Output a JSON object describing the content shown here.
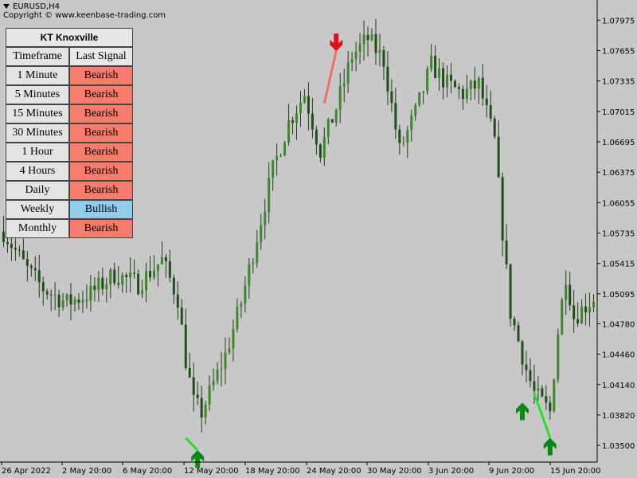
{
  "header": {
    "symbol_line": "EURUSD,H4",
    "copyright": "Copyright © www.keenbase-trading.com"
  },
  "panel": {
    "title": "KT Knoxville",
    "col_timeframe": "Timeframe",
    "col_signal": "Last Signal",
    "rows": [
      {
        "timeframe": "1 Minute",
        "signal": "Bearish"
      },
      {
        "timeframe": "5 Minutes",
        "signal": "Bearish"
      },
      {
        "timeframe": "15 Minutes",
        "signal": "Bearish"
      },
      {
        "timeframe": "30 Minutes",
        "signal": "Bearish"
      },
      {
        "timeframe": "1 Hour",
        "signal": "Bearish"
      },
      {
        "timeframe": "4 Hours",
        "signal": "Bearish"
      },
      {
        "timeframe": "Daily",
        "signal": "Bearish"
      },
      {
        "timeframe": "Weekly",
        "signal": "Bullish"
      },
      {
        "timeframe": "Monthly",
        "signal": "Bearish"
      }
    ],
    "colors": {
      "Bearish": "#f87c6c",
      "Bullish": "#8fcdea"
    }
  },
  "chart_data": {
    "type": "candlestick",
    "symbol": "EURUSD",
    "timeframe": "H4",
    "ylim": [
      1.0335,
      1.0812
    ],
    "yticks": [
      "1.07975",
      "1.07655",
      "1.07335",
      "1.07015",
      "1.06695",
      "1.06375",
      "1.06055",
      "1.05735",
      "1.05415",
      "1.05095",
      "1.04780",
      "1.04460",
      "1.04140",
      "1.03820",
      "1.03500"
    ],
    "xticks": [
      "26 Apr 2022",
      "2 May 20:00",
      "6 May 20:00",
      "12 May 20:00",
      "18 May 20:00",
      "24 May 20:00",
      "30 May 20:00",
      "3 Jun 20:00",
      "9 Jun 20:00",
      "15 Jun 20:00"
    ],
    "candle_count": 150,
    "close_path": [
      [
        0,
        1.0575
      ],
      [
        6,
        1.0535
      ],
      [
        10,
        1.0515
      ],
      [
        16,
        1.05
      ],
      [
        22,
        1.051
      ],
      [
        28,
        1.053
      ],
      [
        34,
        1.052
      ],
      [
        40,
        1.0545
      ],
      [
        44,
        1.0505
      ],
      [
        46,
        1.044
      ],
      [
        48,
        1.0395
      ],
      [
        50,
        1.0385
      ],
      [
        52,
        1.0405
      ],
      [
        56,
        1.0445
      ],
      [
        60,
        1.05
      ],
      [
        64,
        1.057
      ],
      [
        68,
        1.064
      ],
      [
        72,
        1.069
      ],
      [
        76,
        1.072
      ],
      [
        80,
        1.066
      ],
      [
        84,
        1.0705
      ],
      [
        88,
        1.076
      ],
      [
        92,
        1.0778
      ],
      [
        96,
        1.0755
      ],
      [
        100,
        1.066
      ],
      [
        104,
        1.07
      ],
      [
        108,
        1.075
      ],
      [
        112,
        1.073
      ],
      [
        116,
        1.072
      ],
      [
        120,
        1.073
      ],
      [
        124,
        1.067
      ],
      [
        126,
        1.0575
      ],
      [
        128,
        1.049
      ],
      [
        132,
        1.043
      ],
      [
        134,
        1.0405
      ],
      [
        138,
        1.0385
      ],
      [
        140,
        1.047
      ],
      [
        142,
        1.053
      ],
      [
        144,
        1.0485
      ],
      [
        149,
        1.0505
      ]
    ],
    "signals": [
      {
        "type": "sell",
        "label": "Bearish arrow",
        "at_index": 84,
        "price": 1.0765,
        "color": "#e01010",
        "line_from_index": 81,
        "line_from_price": 1.071,
        "line_color": "#f07060"
      },
      {
        "type": "buy",
        "label": "Bullish arrow",
        "at_index": 49,
        "price": 1.0345,
        "color": "#0a8a14",
        "line_from_index": 46,
        "line_from_price": 1.0358,
        "line_color": "#22e622"
      },
      {
        "type": "buy",
        "label": "Bullish arrow",
        "at_index": 131,
        "price": 1.0395,
        "color": "#0a8a14"
      },
      {
        "type": "buy",
        "label": "Bullish arrow",
        "at_index": 138,
        "price": 1.0358,
        "color": "#0a8a14",
        "line_from_index": 134,
        "line_from_price": 1.0405,
        "line_color": "#22e622"
      }
    ],
    "colors": {
      "candle": "#3a8a2a",
      "candle_dark": "#20501a",
      "wick": "#1e3e14",
      "background": "#c8c8c8"
    }
  }
}
